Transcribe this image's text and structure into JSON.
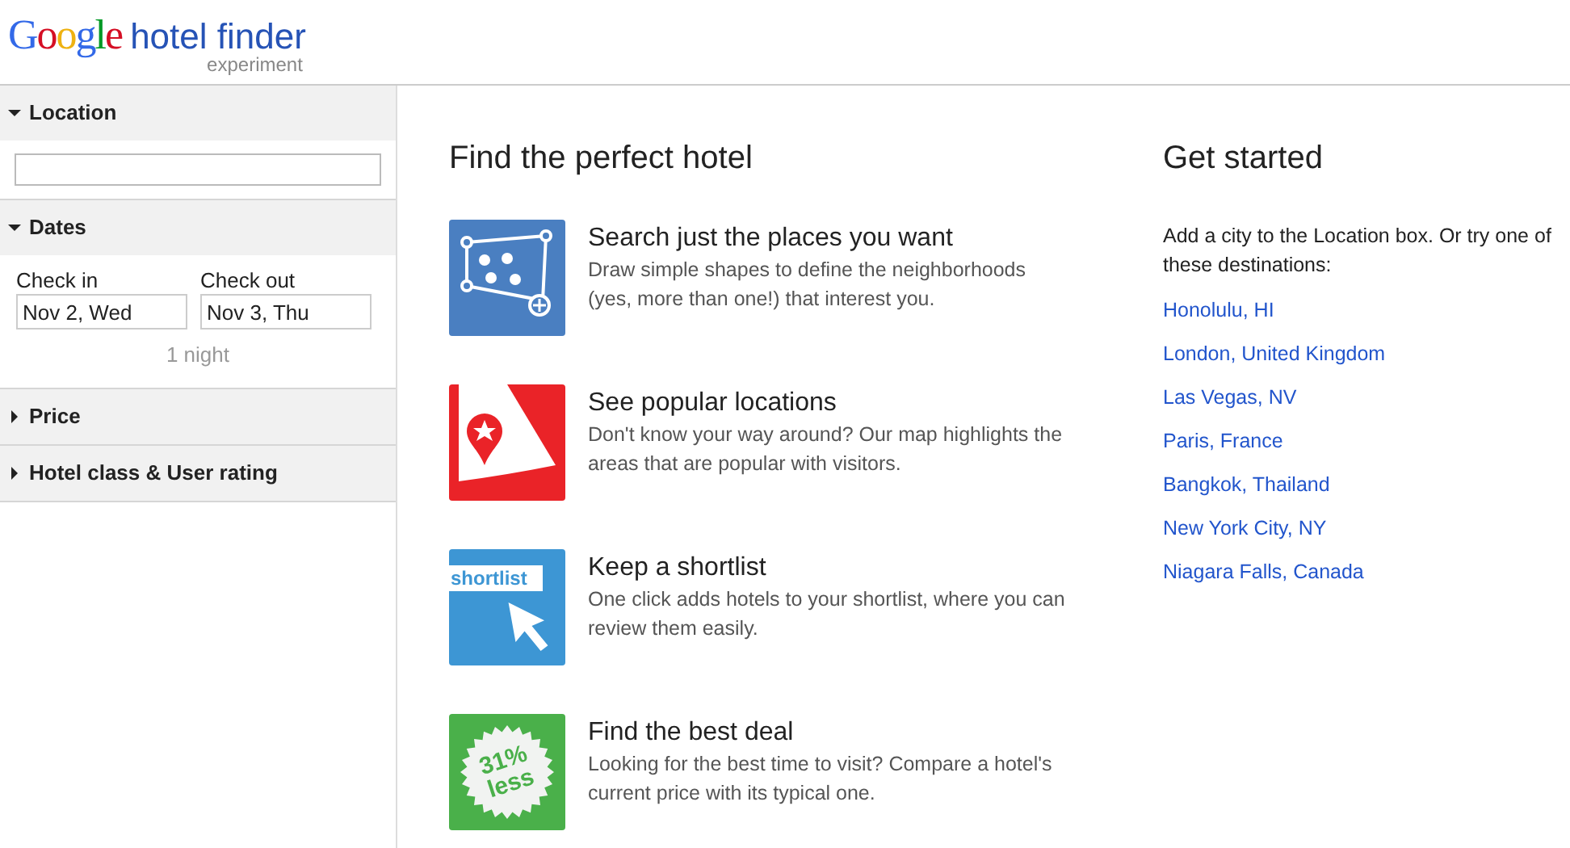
{
  "logo": {
    "brand": "Google",
    "product": "hotel finder",
    "tag": "experiment"
  },
  "sidebar": {
    "sections": [
      {
        "kind": "location",
        "title": "Location",
        "expanded": true
      },
      {
        "kind": "dates",
        "title": "Dates",
        "expanded": true,
        "check_in": {
          "label": "Check in",
          "value": "Nov 2, Wed"
        },
        "check_out": {
          "label": "Check out",
          "value": "Nov 3, Thu"
        },
        "nights": "1 night"
      },
      {
        "title": "Price",
        "expanded": false
      },
      {
        "title": "Hotel class & User rating",
        "expanded": false
      }
    ]
  },
  "features": {
    "title": "Find the perfect hotel",
    "items": [
      {
        "kind": "shapes",
        "title": "Search just the places you want",
        "text": "Draw simple shapes to define the neighborhoods (yes, more than one!) that interest you."
      },
      {
        "kind": "map",
        "title": "See popular locations",
        "text": "Don't know your way around? Our map highlights the areas that are popular with visitors."
      },
      {
        "kind": "shortlist",
        "badge": "shortlist",
        "title": "Keep a shortlist",
        "text": "One click adds hotels to your shortlist, where you can review them easily."
      },
      {
        "kind": "deal",
        "badge": "31%",
        "badge2": "less",
        "title": "Find the best deal",
        "text": "Looking for the best time to visit? Compare a hotel's current price with its typical one."
      }
    ]
  },
  "get_started": {
    "title": "Get started",
    "intro": "Add a city to the Location box. Or try one of these destinations:",
    "destinations": [
      "Honolulu, HI",
      "London, United Kingdom",
      "Las Vegas, NV",
      "Paris, France",
      "Bangkok, Thailand",
      "New York City, NY",
      "Niagara Falls, Canada"
    ]
  }
}
